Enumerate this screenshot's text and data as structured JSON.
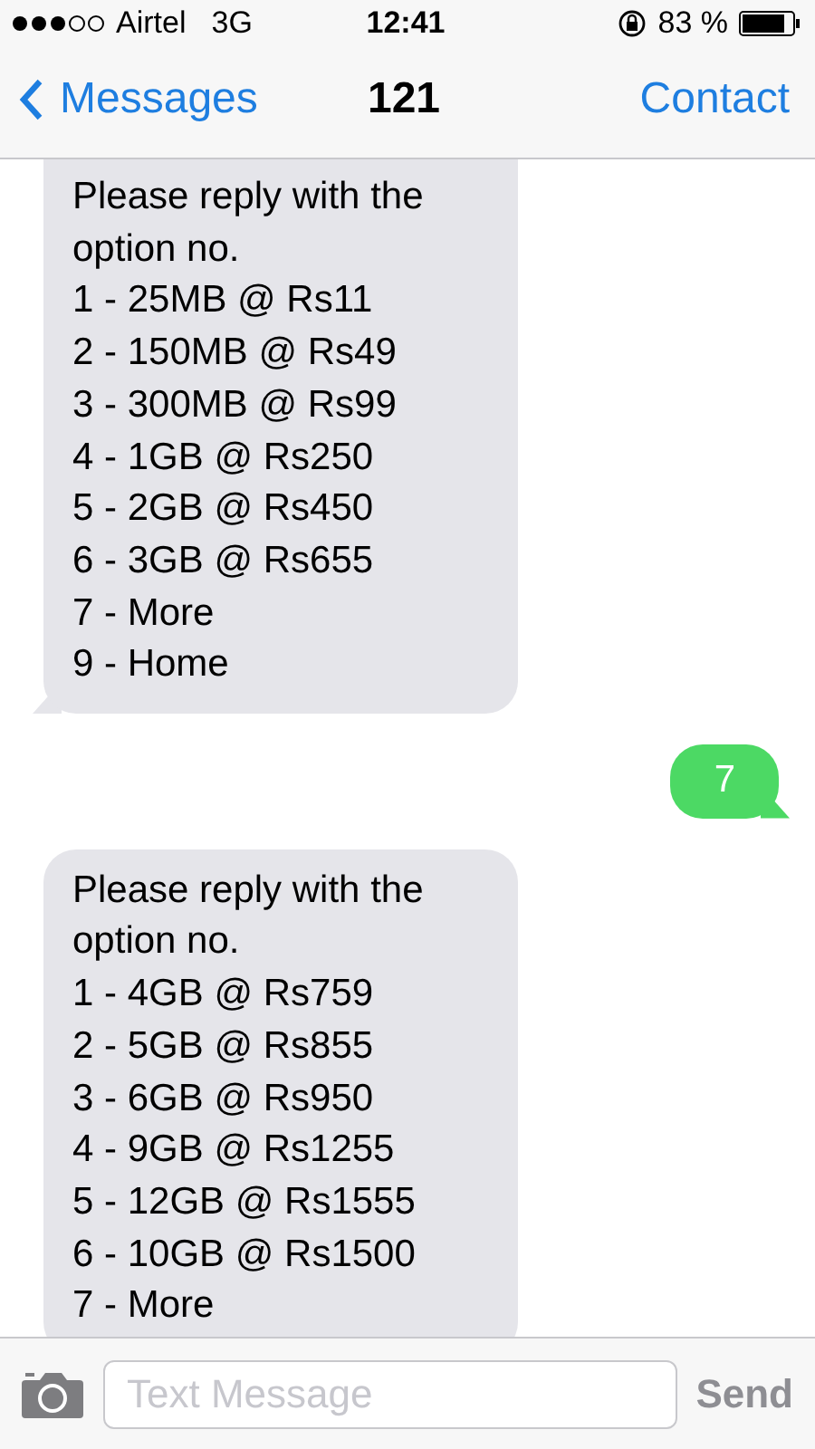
{
  "status_bar": {
    "carrier": "Airtel",
    "network": "3G",
    "time": "12:41",
    "battery": "83 %"
  },
  "nav": {
    "back": "Messages",
    "title": "121",
    "action": "Contact"
  },
  "messages": [
    {
      "kind": "received",
      "lines": [
        "Please reply with the",
        "option no.",
        "1 - 25MB @ Rs11",
        "2 - 150MB @ Rs49",
        "3 - 300MB @ Rs99",
        "4 - 1GB @ Rs250",
        "5 - 2GB @ Rs450",
        "6 - 3GB @ Rs655",
        "7 - More",
        "9 - Home"
      ]
    },
    {
      "kind": "sent",
      "lines": [
        "7"
      ]
    },
    {
      "kind": "received",
      "lines": [
        "Please reply with the",
        "option no.",
        "1 - 4GB @ Rs759",
        "2 - 5GB @ Rs855",
        "3 - 6GB @ Rs950",
        "4 - 9GB @ Rs1255",
        "5 - 12GB @ Rs1555",
        "6 - 10GB @ Rs1500",
        "7 - More"
      ]
    }
  ],
  "composer": {
    "placeholder": "Text Message",
    "send": "Send",
    "send_disabled": true
  }
}
